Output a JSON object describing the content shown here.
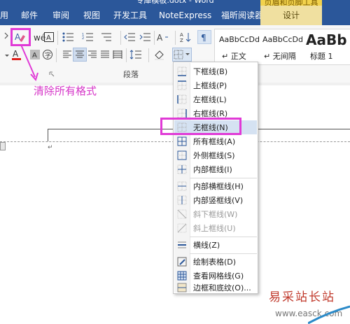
{
  "window": {
    "title": "专庫模板.dotx - Word",
    "contextual_tab_group": "页眉和页脚工具"
  },
  "tabs": [
    "用",
    "邮件",
    "审阅",
    "视图",
    "开发工具",
    "NoteExpress",
    "福昕阅读器"
  ],
  "contextual_tab": "设计",
  "ribbon": {
    "paragraph_group_label": "段落",
    "styles": [
      {
        "sample": "AaBbCcDd",
        "name": "↵ 正文"
      },
      {
        "sample": "AaBbCcDd",
        "name": "↵ 无间隔"
      },
      {
        "sample": "AaBb",
        "name": "标题 1"
      }
    ]
  },
  "annotation": {
    "text": "清除所有格式",
    "color": "#e03ad6"
  },
  "borders_menu": {
    "items": [
      {
        "label": "下框线(B)",
        "icon": "bottom-border-icon",
        "enabled": true
      },
      {
        "label": "上框线(P)",
        "icon": "top-border-icon",
        "enabled": true
      },
      {
        "label": "左框线(L)",
        "icon": "left-border-icon",
        "enabled": true
      },
      {
        "label": "右框线(R)",
        "icon": "right-border-icon",
        "enabled": true
      },
      {
        "label": "无框线(N)",
        "icon": "no-border-icon",
        "enabled": true,
        "selected": true
      },
      {
        "label": "所有框线(A)",
        "icon": "all-borders-icon",
        "enabled": true
      },
      {
        "label": "外侧框线(S)",
        "icon": "outside-borders-icon",
        "enabled": true
      },
      {
        "label": "内部框线(I)",
        "icon": "inside-borders-icon",
        "enabled": true
      },
      {
        "label": "内部横框线(H)",
        "icon": "inside-horizontal-border-icon",
        "enabled": true
      },
      {
        "label": "内部竖框线(V)",
        "icon": "inside-vertical-border-icon",
        "enabled": true
      },
      {
        "label": "斜下框线(W)",
        "icon": "diagonal-down-border-icon",
        "enabled": false
      },
      {
        "label": "斜上框线(U)",
        "icon": "diagonal-up-border-icon",
        "enabled": false
      },
      {
        "label": "横线(Z)",
        "icon": "horizontal-line-icon",
        "enabled": true
      },
      {
        "label": "绘制表格(D)",
        "icon": "draw-table-icon",
        "enabled": true
      },
      {
        "label": "查看网格线(G)",
        "icon": "view-gridlines-icon",
        "enabled": true
      },
      {
        "label": "边框和底纹(O)...",
        "icon": "borders-shading-icon",
        "enabled": true
      }
    ]
  },
  "watermark": {
    "line1": "易采站长站",
    "line2": "www.easck.com"
  },
  "colors": {
    "ribbon_blue": "#2b579a",
    "highlight_magenta": "#e03ad6",
    "selected_item": "#d5e2f2",
    "font_color_red": "#e0201c"
  }
}
